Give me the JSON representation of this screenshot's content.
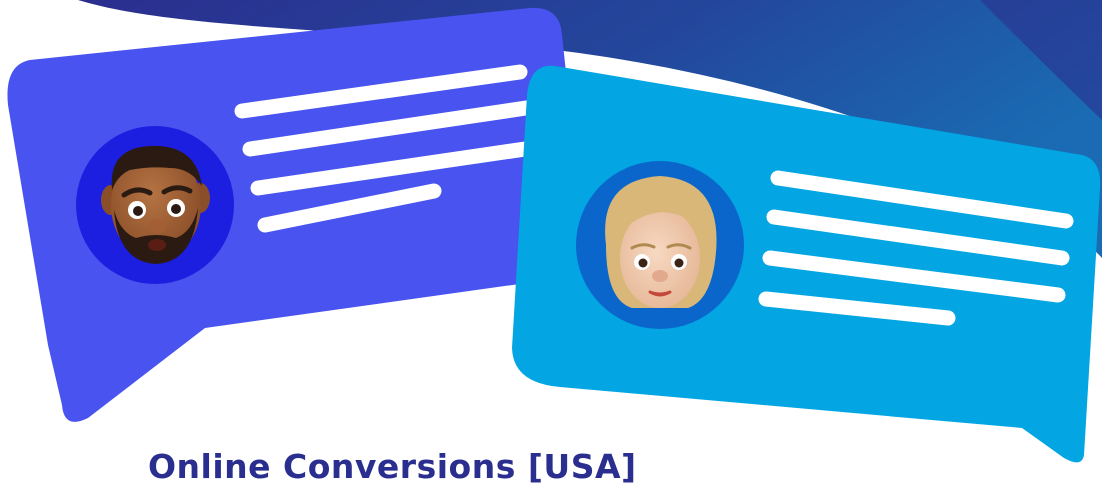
{
  "headline": "Online Conversions [USA]",
  "colors": {
    "banner_dark": "#2b2e8e",
    "banner_mid": "#1f54a6",
    "bubble_left": "#4853f0",
    "bubble_right": "#03a6e3",
    "avatar_left_bg": "#1c1fe0",
    "avatar_right_bg": "#0b66cc",
    "text_lines": "#ffffff",
    "headline": "#2a2f8f"
  },
  "chat_bubbles": [
    {
      "side": "left",
      "avatar": "man-emoji-avatar",
      "text_lines": 4
    },
    {
      "side": "right",
      "avatar": "woman-emoji-avatar",
      "text_lines": 4
    }
  ]
}
